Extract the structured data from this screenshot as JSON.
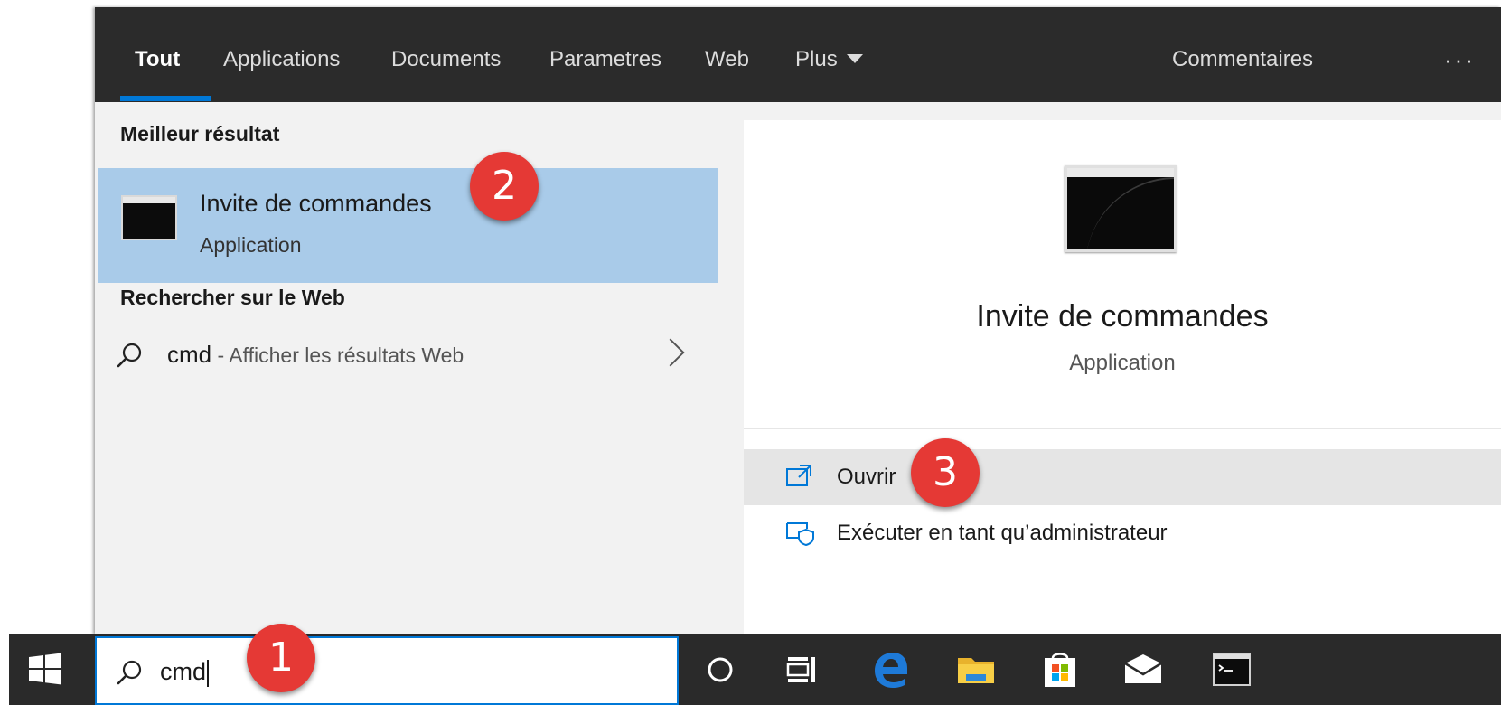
{
  "tabs": [
    {
      "label": "Tout"
    },
    {
      "label": "Applications"
    },
    {
      "label": "Documents"
    },
    {
      "label": "Parametres"
    },
    {
      "label": "Web"
    },
    {
      "label": "Plus"
    }
  ],
  "topbar": {
    "feedback_label": "Commentaires",
    "more_label": "···"
  },
  "left": {
    "best_header": "Meilleur résultat",
    "best": {
      "name": "Invite de commandes",
      "type": "Application"
    },
    "web_header": "Rechercher sur le Web",
    "web_query": "cmd",
    "web_hint": " - Afficher les résultats Web"
  },
  "preview": {
    "name": "Invite de commandes",
    "type": "Application"
  },
  "actions": [
    {
      "label": "Ouvrir",
      "icon": "open-icon"
    },
    {
      "label": "Exécuter en tant qu’administrateur",
      "icon": "run-as-admin-icon"
    }
  ],
  "search": {
    "value": "cmd"
  },
  "badges": [
    "1",
    "2",
    "3"
  ],
  "colors": {
    "accent": "#0078d7",
    "selected": "#a9cbe9",
    "badge": "#e53935",
    "topbar": "#2b2b2b",
    "taskbar": "#2a2a2a"
  }
}
